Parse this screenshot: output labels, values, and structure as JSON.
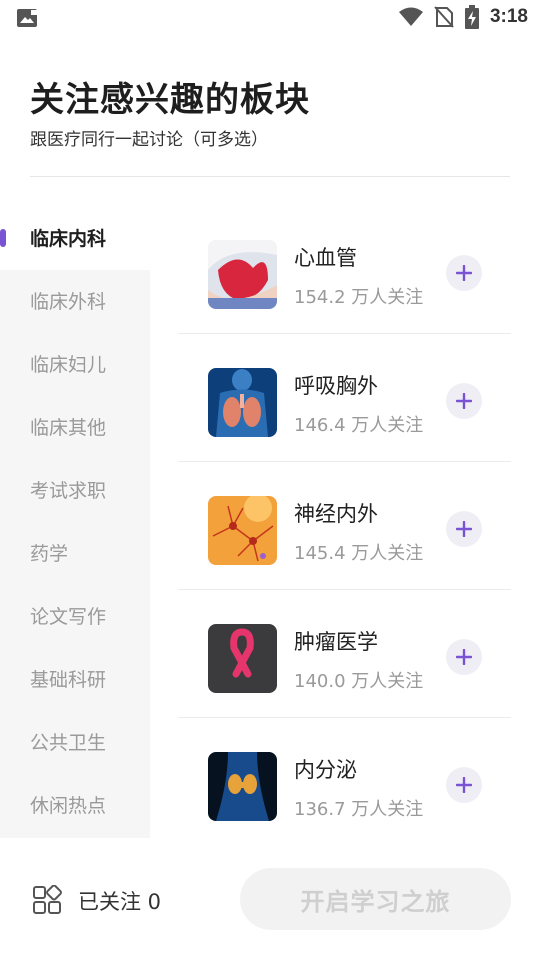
{
  "status_bar": {
    "time": "3:18",
    "icons": [
      "image-icon",
      "wifi-icon",
      "no-sim-icon",
      "battery-charging-icon"
    ]
  },
  "header": {
    "title": "关注感兴趣的板块",
    "subtitle": "跟医疗同行一起讨论（可多选）"
  },
  "sidebar": {
    "active_index": 0,
    "items": [
      {
        "label": "临床内科"
      },
      {
        "label": "临床外科"
      },
      {
        "label": "临床妇儿"
      },
      {
        "label": "临床其他"
      },
      {
        "label": "考试求职"
      },
      {
        "label": "药学"
      },
      {
        "label": "论文写作"
      },
      {
        "label": "基础科研"
      },
      {
        "label": "公共卫生"
      },
      {
        "label": "休闲热点"
      }
    ]
  },
  "topics": [
    {
      "name": "心血管",
      "followers": "154.2 万人关注",
      "icon": "heart-in-hands-icon"
    },
    {
      "name": "呼吸胸外",
      "followers": "146.4 万人关注",
      "icon": "lungs-icon"
    },
    {
      "name": "神经内外",
      "followers": "145.4 万人关注",
      "icon": "neurons-icon"
    },
    {
      "name": "肿瘤医学",
      "followers": "140.0 万人关注",
      "icon": "pink-ribbon-icon"
    },
    {
      "name": "内分泌",
      "followers": "136.7 万人关注",
      "icon": "thyroid-icon"
    }
  ],
  "colors": {
    "accent": "#7a52d4",
    "active_text": "#1e1e1e",
    "inactive_text": "#9a9a9a"
  },
  "bottom_bar": {
    "followed_label": "已关注 0",
    "start_button": "开启学习之旅"
  }
}
